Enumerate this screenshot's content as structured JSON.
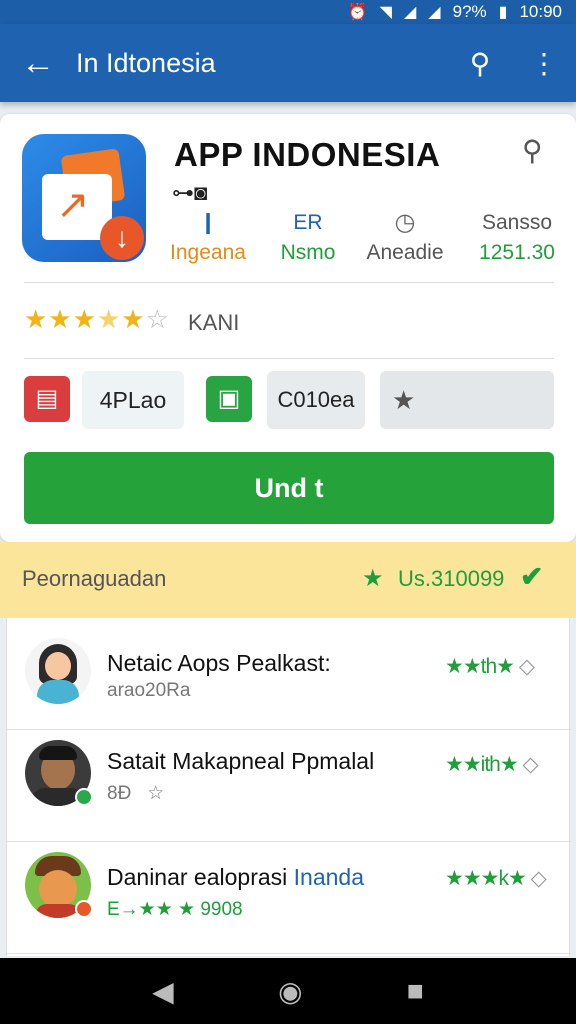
{
  "status_bar": {
    "battery": "9?%",
    "time": "10:90"
  },
  "app_bar": {
    "title": "In Idtonesia"
  },
  "app": {
    "name": "APP INDONESIA",
    "stats": [
      {
        "top": "❙",
        "bottom": "Ingeana"
      },
      {
        "top": "ER",
        "bottom": "Nsmo"
      },
      {
        "top": "◷",
        "bottom": "Aneadie"
      },
      {
        "top": "Sansso",
        "bottom": "1251.30"
      }
    ],
    "rating": {
      "stars": 4.5,
      "label": "KANI"
    },
    "actions": {
      "box1": "4PLao",
      "box2": "C010ea"
    },
    "install_label": "Und t"
  },
  "banner": {
    "label": "Peornaguadan",
    "value": "Us.310099"
  },
  "reviews": [
    {
      "name": "Netaic Aops Pealkast:",
      "meta": "arao20Ra",
      "stars": "★★th★"
    },
    {
      "name": "Satait Makapneal Ppmalal",
      "meta": "8Đ",
      "stars": "★★ith★"
    },
    {
      "name": "Daninar ealoprasi",
      "name_highlight": "Inanda",
      "meta": "E→★★ ★ 9908",
      "stars": "★★★k★"
    }
  ],
  "colors": {
    "app_bar": "#1e62b0",
    "install": "#25a33a",
    "banner": "#fae59a",
    "accent_green": "#1f9e3a"
  },
  "icons": [
    "back-arrow-icon",
    "search-icon",
    "more-vert-icon",
    "download-icon",
    "star-icon",
    "check-icon",
    "nav-back-icon",
    "nav-home-icon",
    "nav-recents-icon"
  ]
}
